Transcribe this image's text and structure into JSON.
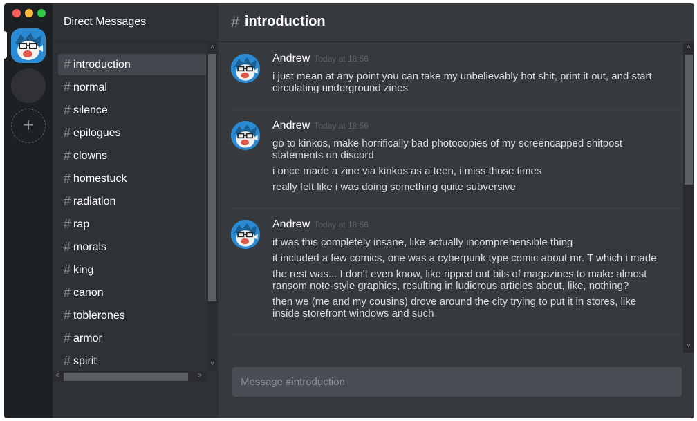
{
  "sidebar": {
    "title": "Direct Messages",
    "channels": [
      {
        "name": "introduction",
        "active": true
      },
      {
        "name": "normal"
      },
      {
        "name": "silence"
      },
      {
        "name": "epilogues"
      },
      {
        "name": "clowns"
      },
      {
        "name": "homestuck"
      },
      {
        "name": "radiation"
      },
      {
        "name": "rap"
      },
      {
        "name": "morals"
      },
      {
        "name": "king"
      },
      {
        "name": "canon"
      },
      {
        "name": "toblerones"
      },
      {
        "name": "armor"
      },
      {
        "name": "spirit"
      }
    ]
  },
  "chat": {
    "hash": "#",
    "channel_title": "introduction",
    "messages": [
      {
        "author": "Andrew",
        "time": "Today at 18:56",
        "lines": [
          "i just mean at any point you can take my unbelievably hot shit, print it out, and start circulating underground zines"
        ]
      },
      {
        "author": "Andrew",
        "time": "Today at 18:56",
        "lines": [
          "go to kinkos, make horrifically bad photocopies of my screencapped shitpost statements on discord",
          "i once made a zine via kinkos as a teen, i miss those times",
          "really felt like i was doing something quite subversive"
        ]
      },
      {
        "author": "Andrew",
        "time": "Today at 18:56",
        "lines": [
          "it was this completely insane, like actually incomprehensible thing",
          "it included a few comics, one was a cyberpunk type comic about mr. T which i made",
          "the rest was... I don't even know, like ripped out bits of magazines to make almost ransom note-style graphics, resulting in ludicrous articles about, like, nothing?",
          "then we (me and my cousins) drove around the city trying to put it in stores, like inside storefront windows and such"
        ]
      }
    ],
    "composer_placeholder": "Message #introduction"
  },
  "colors": {
    "background": "#36393e",
    "sidebar": "#2e3136",
    "guilds": "#1e2124",
    "avatar_blue": "#2a8bd4"
  }
}
